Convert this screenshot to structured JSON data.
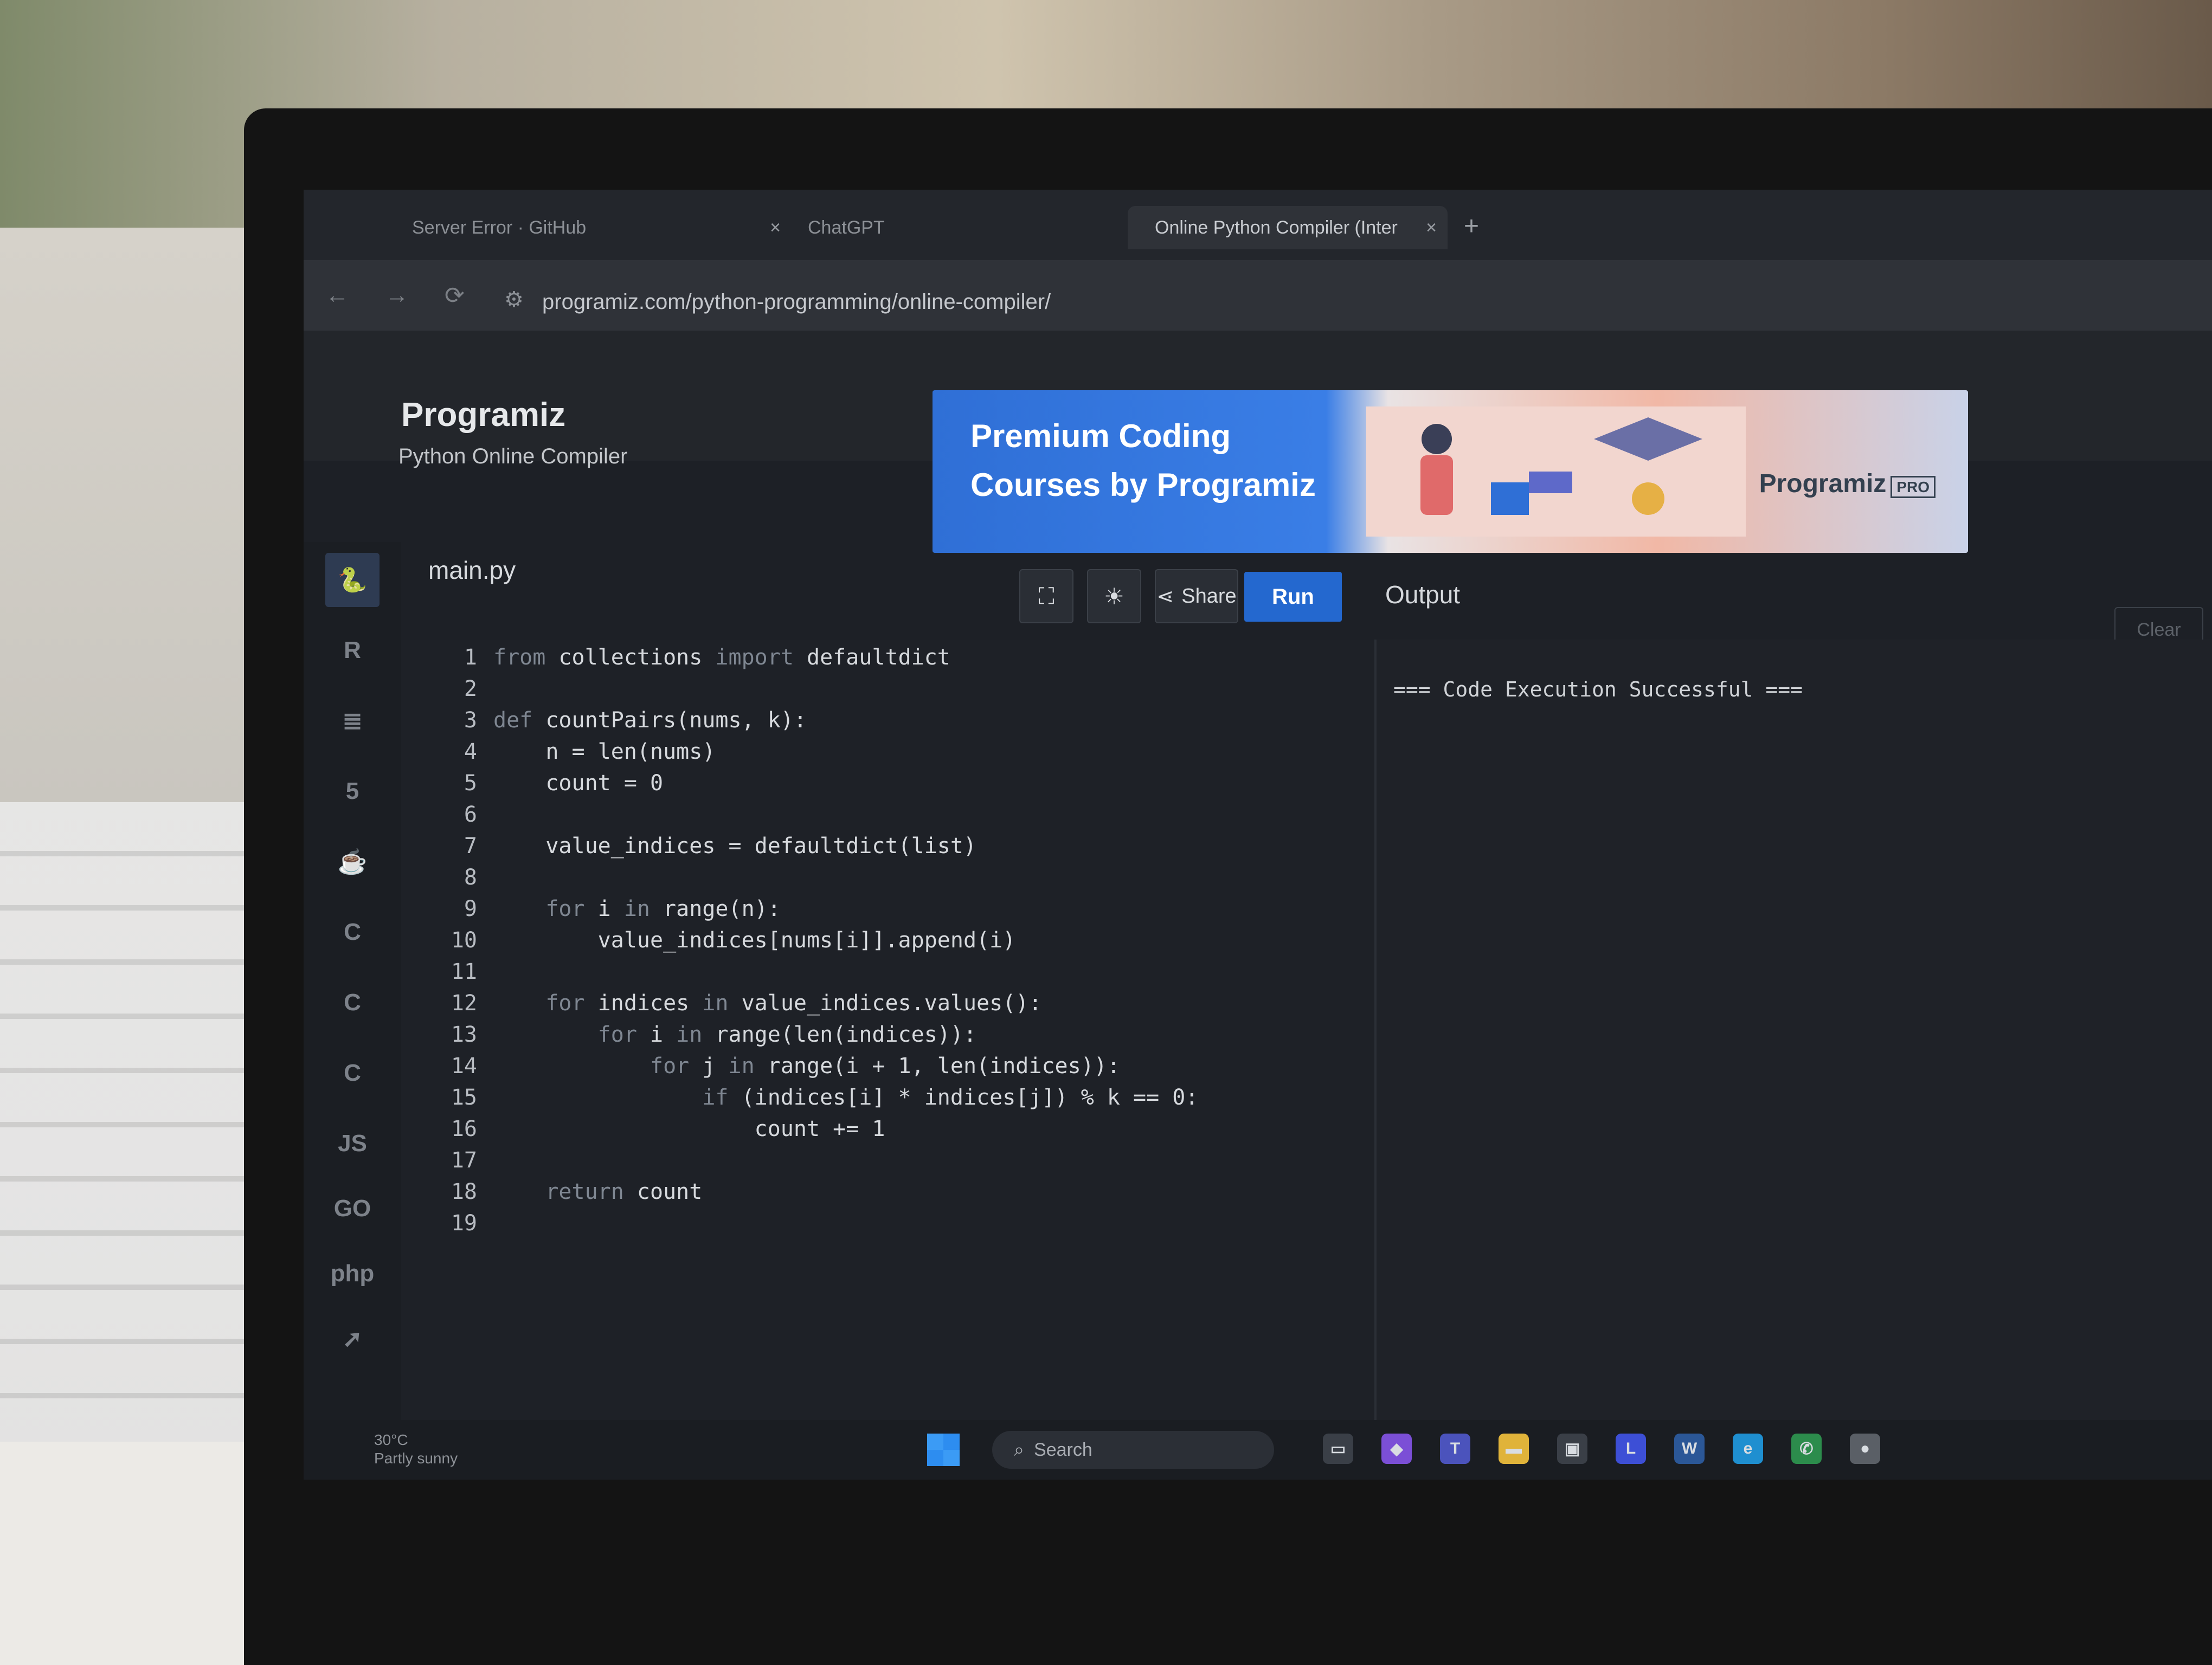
{
  "browser": {
    "tabs": [
      {
        "label": "Server Error · GitHub",
        "close": "×",
        "active": false
      },
      {
        "label": "ChatGPT",
        "close": "×",
        "active": false
      },
      {
        "label": "Online Python Compiler (Inter",
        "close": "×",
        "active": true
      }
    ],
    "new_tab": "+",
    "back": "←",
    "forward": "→",
    "reload": "⟳",
    "url": "programiz.com/python-programming/online-compiler/"
  },
  "header": {
    "logo": "Programiz",
    "subtitle": "Python Online Compiler"
  },
  "banner": {
    "line1": "Premium Coding",
    "line2": "Courses by Programiz",
    "brand": "Programiz",
    "brand_badge": "PRO"
  },
  "sidebar": {
    "items": [
      {
        "icon": "python-icon",
        "glyph": "🐍",
        "active": true
      },
      {
        "icon": "r-icon",
        "glyph": "R",
        "active": false
      },
      {
        "icon": "database-icon",
        "glyph": "≣",
        "active": false
      },
      {
        "icon": "html5-icon",
        "glyph": "5",
        "active": false
      },
      {
        "icon": "java-icon",
        "glyph": "☕",
        "active": false
      },
      {
        "icon": "c-icon",
        "glyph": "C",
        "active": false
      },
      {
        "icon": "cpp-icon",
        "glyph": "C",
        "active": false
      },
      {
        "icon": "csharp-icon",
        "glyph": "C",
        "active": false
      },
      {
        "icon": "js-icon",
        "glyph": "JS",
        "active": false
      },
      {
        "icon": "go-icon",
        "glyph": "GO",
        "active": false
      },
      {
        "icon": "php-icon",
        "glyph": "php",
        "active": false
      },
      {
        "icon": "swift-icon",
        "glyph": "➚",
        "active": false
      }
    ]
  },
  "editor": {
    "filename": "main.py",
    "fullscreen_glyph": "⛶",
    "theme_glyph": "☀",
    "share_label": "Share",
    "run_label": "Run",
    "lines": [
      {
        "n": "1",
        "text": "from collections import defaultdict"
      },
      {
        "n": "2",
        "text": ""
      },
      {
        "n": "3",
        "text": "def countPairs(nums, k):"
      },
      {
        "n": "4",
        "text": "    n = len(nums)"
      },
      {
        "n": "5",
        "text": "    count = 0"
      },
      {
        "n": "6",
        "text": ""
      },
      {
        "n": "7",
        "text": "    value_indices = defaultdict(list)"
      },
      {
        "n": "8",
        "text": ""
      },
      {
        "n": "9",
        "text": "    for i in range(n):"
      },
      {
        "n": "10",
        "text": "        value_indices[nums[i]].append(i)"
      },
      {
        "n": "11",
        "text": ""
      },
      {
        "n": "12",
        "text": "    for indices in value_indices.values():"
      },
      {
        "n": "13",
        "text": "        for i in range(len(indices)):"
      },
      {
        "n": "14",
        "text": "            for j in range(i + 1, len(indices)):"
      },
      {
        "n": "15",
        "text": "                if (indices[i] * indices[j]) % k == 0:"
      },
      {
        "n": "16",
        "text": "                    count += 1"
      },
      {
        "n": "17",
        "text": ""
      },
      {
        "n": "18",
        "text": "    return count"
      },
      {
        "n": "19",
        "text": ""
      }
    ]
  },
  "output": {
    "title": "Output",
    "clear_label": "Clear",
    "text": "=== Code Execution Successful ==="
  },
  "taskbar": {
    "temperature": "30°C",
    "weather": "Partly sunny",
    "search_label": "Search",
    "apps": [
      {
        "icon": "file-explorer-icon",
        "glyph": "▭",
        "color": "#3a3f47"
      },
      {
        "icon": "copilot-icon",
        "glyph": "◆",
        "color": "#7b4fd6"
      },
      {
        "icon": "teams-icon",
        "glyph": "T",
        "color": "#4b53bc"
      },
      {
        "icon": "folder-icon",
        "glyph": "▬",
        "color": "#e0b33a"
      },
      {
        "icon": "store-icon",
        "glyph": "▣",
        "color": "#3a3f47"
      },
      {
        "icon": "app-l-icon",
        "glyph": "L",
        "color": "#3d4fd6"
      },
      {
        "icon": "word-icon",
        "glyph": "W",
        "color": "#2b5797"
      },
      {
        "icon": "edge-icon",
        "glyph": "e",
        "color": "#1f8fd0"
      },
      {
        "icon": "whatsapp-icon",
        "glyph": "✆",
        "color": "#2c8c4c"
      },
      {
        "icon": "chrome-icon",
        "glyph": "●",
        "color": "#5a5f66"
      }
    ]
  }
}
